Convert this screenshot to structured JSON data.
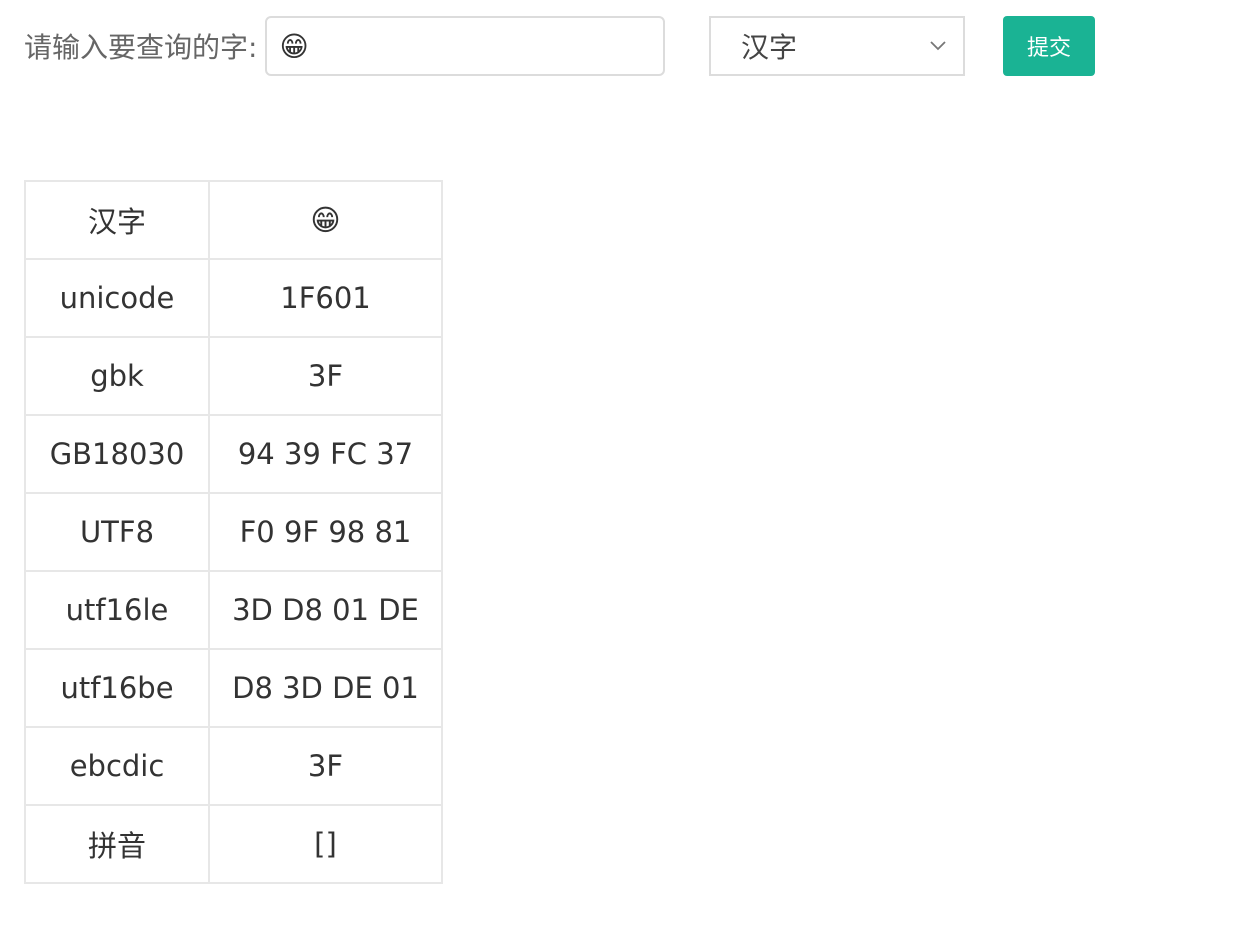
{
  "query": {
    "label": "请输入要查询的字:",
    "input_value": "😁"
  },
  "select": {
    "value": "汉字"
  },
  "submit": {
    "label": "提交",
    "color": "#1ab394"
  },
  "table": {
    "rows": [
      {
        "key": "汉字",
        "value": "😁"
      },
      {
        "key": "unicode",
        "value": "1F601"
      },
      {
        "key": "gbk",
        "value": "3F"
      },
      {
        "key": "GB18030",
        "value": "94 39 FC 37"
      },
      {
        "key": "UTF8",
        "value": "F0 9F 98 81"
      },
      {
        "key": "utf16le",
        "value": "3D D8 01 DE"
      },
      {
        "key": "utf16be",
        "value": "D8 3D DE 01"
      },
      {
        "key": "ebcdic",
        "value": "3F"
      },
      {
        "key": "拼音",
        "value": "[]"
      }
    ]
  },
  "icons": {
    "select_arrow": "chevron-down-icon"
  }
}
